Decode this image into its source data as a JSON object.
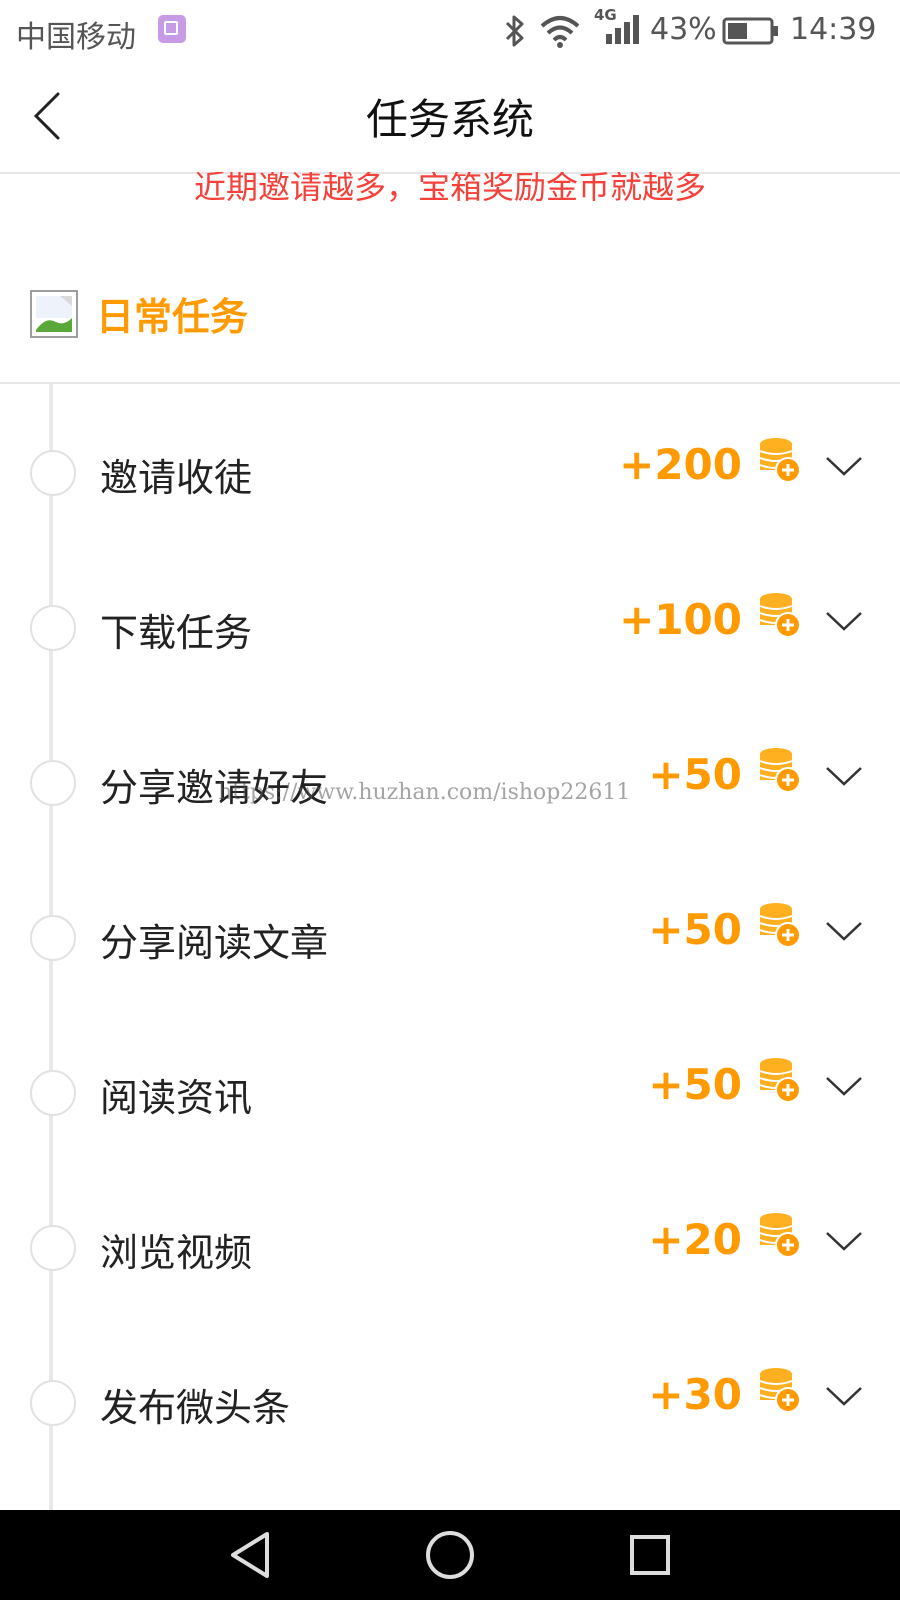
{
  "status_bar": {
    "carrier": "中国移动",
    "network": "4G",
    "battery": "43%",
    "time": "14:39",
    "icons": [
      "image-notification-icon",
      "bluetooth-icon",
      "wifi-icon",
      "signal-icon",
      "battery-icon"
    ]
  },
  "header": {
    "title": "任务系统",
    "back_icon": "back-arrow-icon"
  },
  "promo": {
    "text": "近期邀请越多，宝箱奖励金币就越多"
  },
  "section": {
    "title": "日常任务",
    "icon": "broken-image-icon"
  },
  "tasks": [
    {
      "label": "邀请收徒",
      "reward": "+200"
    },
    {
      "label": "下载任务",
      "reward": "+100"
    },
    {
      "label": "分享邀请好友",
      "reward": "+50"
    },
    {
      "label": "分享阅读文章",
      "reward": "+50"
    },
    {
      "label": "阅读资讯",
      "reward": "+50"
    },
    {
      "label": "浏览视频",
      "reward": "+20"
    },
    {
      "label": "发布微头条",
      "reward": "+30"
    }
  ],
  "watermark": "https://www.huzhan.com/ishop22611",
  "colors": {
    "accent": "#ff9a00",
    "promo": "#f5413a",
    "divider": "#e6e6e6",
    "nav_bar": "#000000"
  },
  "nav_bar": {
    "icons": [
      "nav-back-icon",
      "nav-home-icon",
      "nav-recents-icon"
    ]
  }
}
